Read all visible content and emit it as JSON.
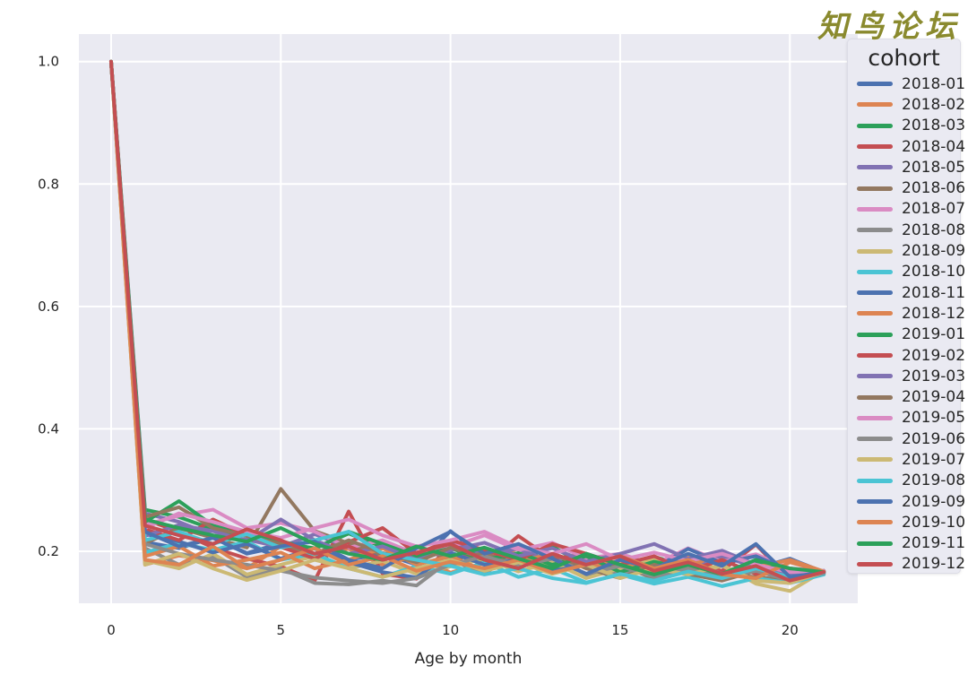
{
  "watermark": {
    "text": "知鸟论坛",
    "color": "#8a8a2e"
  },
  "style": {
    "plot_bg": "#eaeaf2",
    "figure_bg": "#ffffff",
    "grid_color": "#ffffff",
    "text_color": "#262626"
  },
  "legend": {
    "title": "cohort",
    "entries": [
      {
        "label": "2018-01",
        "color": "#4c72b0"
      },
      {
        "label": "2018-02",
        "color": "#dd8452"
      },
      {
        "label": "2018-03",
        "color": "#2ca05a"
      },
      {
        "label": "2018-04",
        "color": "#c44e52"
      },
      {
        "label": "2018-05",
        "color": "#8172b3"
      },
      {
        "label": "2018-06",
        "color": "#937860"
      },
      {
        "label": "2018-07",
        "color": "#da8bc3"
      },
      {
        "label": "2018-08",
        "color": "#8c8c8c"
      },
      {
        "label": "2018-09",
        "color": "#ccb974"
      },
      {
        "label": "2018-10",
        "color": "#4bc4d4"
      },
      {
        "label": "2018-11",
        "color": "#4c72b0"
      },
      {
        "label": "2018-12",
        "color": "#dd8452"
      },
      {
        "label": "2019-01",
        "color": "#2ca05a"
      },
      {
        "label": "2019-02",
        "color": "#c44e52"
      },
      {
        "label": "2019-03",
        "color": "#8172b3"
      },
      {
        "label": "2019-04",
        "color": "#937860"
      },
      {
        "label": "2019-05",
        "color": "#da8bc3"
      },
      {
        "label": "2019-06",
        "color": "#8c8c8c"
      },
      {
        "label": "2019-07",
        "color": "#ccb974"
      },
      {
        "label": "2019-08",
        "color": "#4bc4d4"
      },
      {
        "label": "2019-09",
        "color": "#4c72b0"
      },
      {
        "label": "2019-10",
        "color": "#dd8452"
      },
      {
        "label": "2019-11",
        "color": "#2ca05a"
      },
      {
        "label": "2019-12",
        "color": "#c44e52"
      }
    ]
  },
  "chart_data": {
    "type": "line",
    "title": "",
    "xlabel": "Age by month",
    "ylabel": "",
    "xlim": [
      -0.95,
      22.0
    ],
    "ylim": [
      0.115,
      1.045
    ],
    "xticks": [
      0,
      5,
      10,
      15,
      20
    ],
    "yticks": [
      0.2,
      0.4,
      0.6,
      0.8,
      1.0
    ],
    "xtick_labels": [
      "0",
      "5",
      "10",
      "15",
      "20"
    ],
    "ytick_labels": [
      "0.2",
      "0.4",
      "0.6",
      "0.8",
      "1.0"
    ],
    "grid": true,
    "legend_position": "right-outside",
    "legend_title": "cohort",
    "x": [
      0,
      1,
      2,
      3,
      4,
      5,
      6,
      7,
      8,
      9,
      10,
      11,
      12,
      13,
      14,
      15,
      16,
      17,
      18,
      19,
      20,
      21
    ],
    "series": [
      {
        "name": "2018-01",
        "color": "#4c72b0",
        "values": [
          1.0,
          0.215,
          0.205,
          0.222,
          0.197,
          0.213,
          0.204,
          0.186,
          0.196,
          0.178,
          0.233,
          0.189,
          0.176,
          0.192,
          0.162,
          0.172,
          0.182,
          0.166,
          0.198,
          0.172,
          0.188,
          0.166
        ]
      },
      {
        "name": "2018-02",
        "color": "#dd8452",
        "values": [
          1.0,
          0.178,
          0.193,
          0.185,
          0.172,
          0.208,
          0.196,
          0.204,
          0.178,
          0.192,
          0.165,
          0.181,
          0.205,
          0.172,
          0.186,
          0.163,
          0.178,
          0.192,
          0.167,
          0.179,
          0.156,
          0.167
        ]
      },
      {
        "name": "2018-03",
        "color": "#2ca05a",
        "values": [
          1.0,
          0.268,
          0.256,
          0.236,
          0.225,
          0.213,
          0.205,
          0.229,
          0.207,
          0.178,
          0.216,
          0.193,
          0.184,
          0.208,
          0.176,
          0.168,
          0.191,
          0.175,
          0.163,
          0.184,
          0.167,
          0.165
        ]
      },
      {
        "name": "2018-04",
        "color": "#c44e52",
        "values": [
          1.0,
          0.252,
          0.232,
          0.206,
          0.188,
          0.175,
          0.152,
          0.265,
          0.163,
          0.155,
          0.208,
          0.178,
          0.225,
          0.187,
          0.196,
          0.172,
          0.188,
          0.178,
          0.168,
          0.211,
          0.154,
          0.166
        ]
      },
      {
        "name": "2018-05",
        "color": "#8172b3",
        "values": [
          1.0,
          0.262,
          0.248,
          0.226,
          0.219,
          0.207,
          0.228,
          0.206,
          0.197,
          0.185,
          0.213,
          0.196,
          0.204,
          0.182,
          0.194,
          0.173,
          0.185,
          0.167,
          0.192,
          0.174,
          0.161,
          0.168
        ]
      },
      {
        "name": "2018-06",
        "color": "#937860",
        "values": [
          1.0,
          0.213,
          0.238,
          0.222,
          0.206,
          0.302,
          0.233,
          0.213,
          0.194,
          0.208,
          0.186,
          0.197,
          0.176,
          0.188,
          0.163,
          0.178,
          0.155,
          0.172,
          0.162,
          0.158,
          0.152,
          0.163
        ]
      },
      {
        "name": "2018-07",
        "color": "#da8bc3",
        "values": [
          1.0,
          0.243,
          0.258,
          0.268,
          0.238,
          0.246,
          0.232,
          0.206,
          0.218,
          0.195,
          0.207,
          0.226,
          0.202,
          0.214,
          0.188,
          0.196,
          0.178,
          0.205,
          0.183,
          0.195,
          0.172,
          0.168
        ]
      },
      {
        "name": "2018-08",
        "color": "#8c8c8c",
        "values": [
          1.0,
          0.205,
          0.178,
          0.192,
          0.158,
          0.172,
          0.148,
          0.146,
          0.152,
          0.144,
          0.186,
          0.164,
          0.197,
          0.173,
          0.183,
          0.162,
          0.174,
          0.186,
          0.163,
          0.177,
          0.158,
          0.166
        ]
      },
      {
        "name": "2018-09",
        "color": "#ccb974",
        "values": [
          1.0,
          0.185,
          0.172,
          0.196,
          0.162,
          0.178,
          0.192,
          0.172,
          0.184,
          0.163,
          0.175,
          0.188,
          0.167,
          0.182,
          0.156,
          0.172,
          0.186,
          0.162,
          0.178,
          0.147,
          0.135,
          0.168
        ]
      },
      {
        "name": "2018-10",
        "color": "#4bc4d4",
        "values": [
          1.0,
          0.198,
          0.213,
          0.202,
          0.216,
          0.186,
          0.196,
          0.172,
          0.158,
          0.176,
          0.163,
          0.182,
          0.158,
          0.172,
          0.149,
          0.162,
          0.147,
          0.158,
          0.143,
          0.156,
          0.148,
          0.162
        ]
      },
      {
        "name": "2018-11",
        "color": "#4c72b0",
        "values": [
          1.0,
          0.228,
          0.216,
          0.198,
          0.212,
          0.188,
          0.205,
          0.182,
          0.166,
          0.157,
          0.198,
          0.178,
          0.186,
          0.168,
          0.178,
          0.192,
          0.172,
          0.204,
          0.181,
          0.192,
          0.168,
          0.165
        ]
      },
      {
        "name": "2018-12",
        "color": "#dd8452",
        "values": [
          1.0,
          0.192,
          0.208,
          0.176,
          0.186,
          0.198,
          0.172,
          0.186,
          0.205,
          0.178,
          0.192,
          0.168,
          0.183,
          0.196,
          0.172,
          0.185,
          0.166,
          0.178,
          0.162,
          0.174,
          0.186,
          0.167
        ]
      },
      {
        "name": "2019-01",
        "color": "#2ca05a",
        "values": [
          1.0,
          0.248,
          0.282,
          0.242,
          0.228,
          0.216,
          0.204,
          0.232,
          0.212,
          0.192,
          0.205,
          0.186,
          0.197,
          0.178,
          0.192,
          0.166,
          0.183,
          0.172,
          0.158,
          0.176,
          0.162,
          0.168
        ]
      },
      {
        "name": "2019-02",
        "color": "#c44e52",
        "values": [
          1.0,
          0.236,
          0.218,
          0.252,
          0.226,
          0.207,
          0.188,
          0.215,
          0.238,
          0.196,
          0.218,
          0.202,
          0.186,
          0.212,
          0.196,
          0.178,
          0.192,
          0.168,
          0.186,
          0.163,
          0.172,
          0.166
        ]
      },
      {
        "name": "2019-03",
        "color": "#8172b3",
        "values": [
          1.0,
          0.225,
          0.243,
          0.233,
          0.217,
          0.252,
          0.218,
          0.196,
          0.208,
          0.186,
          0.202,
          0.214,
          0.192,
          0.205,
          0.183,
          0.196,
          0.212,
          0.188,
          0.201,
          0.178,
          0.162,
          0.168
        ]
      },
      {
        "name": "2019-04",
        "color": "#937860",
        "values": [
          1.0,
          0.256,
          0.272,
          0.238,
          0.225,
          0.212,
          0.196,
          0.218,
          0.197,
          0.182,
          0.206,
          0.188,
          0.172,
          0.196,
          0.172,
          0.156,
          0.178,
          0.163,
          0.152,
          0.168,
          0.158,
          0.164
        ]
      },
      {
        "name": "2019-05",
        "color": "#da8bc3",
        "values": [
          1.0,
          0.238,
          0.262,
          0.248,
          0.232,
          0.222,
          0.238,
          0.252,
          0.226,
          0.208,
          0.218,
          0.232,
          0.206,
          0.196,
          0.212,
          0.186,
          0.198,
          0.184,
          0.196,
          0.178,
          0.166,
          0.168
        ]
      },
      {
        "name": "2019-06",
        "color": "#8c8c8c",
        "values": [
          1.0,
          0.212,
          0.196,
          0.186,
          0.178,
          0.168,
          0.157,
          0.152,
          0.148,
          0.156,
          0.178,
          0.192,
          0.176,
          0.188,
          0.163,
          0.176,
          0.158,
          0.172,
          0.156,
          0.168,
          0.152,
          0.164
        ]
      },
      {
        "name": "2019-07",
        "color": "#ccb974",
        "values": [
          1.0,
          0.178,
          0.196,
          0.172,
          0.153,
          0.168,
          0.186,
          0.172,
          0.158,
          0.172,
          0.186,
          0.168,
          0.182,
          0.163,
          0.178,
          0.156,
          0.172,
          0.162,
          0.176,
          0.152,
          0.148,
          0.166
        ]
      },
      {
        "name": "2019-08",
        "color": "#4bc4d4",
        "values": [
          1.0,
          0.218,
          0.232,
          0.212,
          0.228,
          0.206,
          0.218,
          0.232,
          0.196,
          0.186,
          0.176,
          0.162,
          0.172,
          0.156,
          0.148,
          0.163,
          0.152,
          0.167,
          0.156,
          0.172,
          0.158,
          0.165
        ]
      },
      {
        "name": "2019-09",
        "color": "#4c72b0",
        "values": [
          1.0,
          0.232,
          0.208,
          0.222,
          0.196,
          0.208,
          0.216,
          0.186,
          0.172,
          0.205,
          0.232,
          0.196,
          0.212,
          0.188,
          0.163,
          0.186,
          0.172,
          0.196,
          0.176,
          0.212,
          0.158,
          0.166
        ]
      },
      {
        "name": "2019-10",
        "color": "#dd8452",
        "values": [
          1.0,
          0.186,
          0.178,
          0.208,
          0.172,
          0.186,
          0.205,
          0.178,
          0.192,
          0.168,
          0.183,
          0.172,
          0.186,
          0.165,
          0.178,
          0.192,
          0.172,
          0.186,
          0.162,
          0.156,
          0.182,
          0.167
        ]
      },
      {
        "name": "2019-11",
        "color": "#2ca05a",
        "values": [
          1.0,
          0.252,
          0.238,
          0.226,
          0.216,
          0.238,
          0.212,
          0.196,
          0.186,
          0.208,
          0.192,
          0.206,
          0.188,
          0.172,
          0.196,
          0.178,
          0.162,
          0.178,
          0.163,
          0.186,
          0.172,
          0.166
        ]
      },
      {
        "name": "2019-12",
        "color": "#c44e52",
        "values": [
          1.0,
          0.242,
          0.226,
          0.212,
          0.236,
          0.218,
          0.196,
          0.208,
          0.186,
          0.198,
          0.212,
          0.186,
          0.172,
          0.196,
          0.178,
          0.192,
          0.168,
          0.182,
          0.163,
          0.176,
          0.152,
          0.166
        ]
      }
    ]
  }
}
